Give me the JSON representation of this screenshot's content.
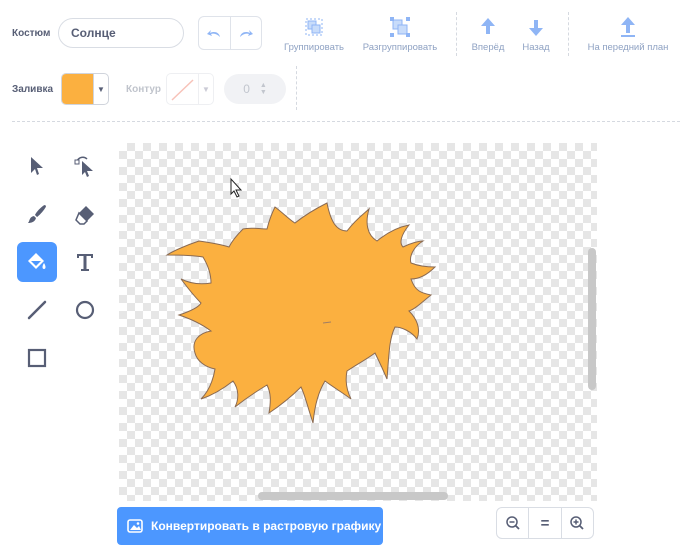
{
  "toolbar": {
    "costume_label": "Костюм",
    "costume_name": "Солнце",
    "group_label": "Группировать",
    "ungroup_label": "Разгруппировать",
    "forward_label": "Вперёд",
    "backward_label": "Назад",
    "front_label": "На передний план"
  },
  "fill": {
    "label": "Заливка",
    "color": "#fbb040"
  },
  "outline": {
    "label": "Контур",
    "width_value": "0"
  },
  "tools": [
    {
      "name": "select-tool",
      "icon": "arrow-icon",
      "active": false
    },
    {
      "name": "reshape-tool",
      "icon": "reshape-icon",
      "active": false
    },
    {
      "name": "brush-tool",
      "icon": "brush-icon",
      "active": false
    },
    {
      "name": "eraser-tool",
      "icon": "eraser-icon",
      "active": false
    },
    {
      "name": "fill-tool",
      "icon": "fill-bucket-icon",
      "active": true
    },
    {
      "name": "text-tool",
      "icon": "text-icon",
      "active": false
    },
    {
      "name": "line-tool",
      "icon": "line-icon",
      "active": false
    },
    {
      "name": "circle-tool",
      "icon": "circle-icon",
      "active": false
    },
    {
      "name": "rectangle-tool",
      "icon": "rectangle-icon",
      "active": false
    }
  ],
  "canvas": {
    "shape_color": "#fbb040",
    "shape_stroke": "#8a6a52"
  },
  "bottom": {
    "convert_label": "Конвертировать в растровую графику",
    "zoom_reset_label": "="
  },
  "colors": {
    "accent": "#4c97ff",
    "text": "#575e75",
    "disabled_icon": "#8fb5f5"
  }
}
